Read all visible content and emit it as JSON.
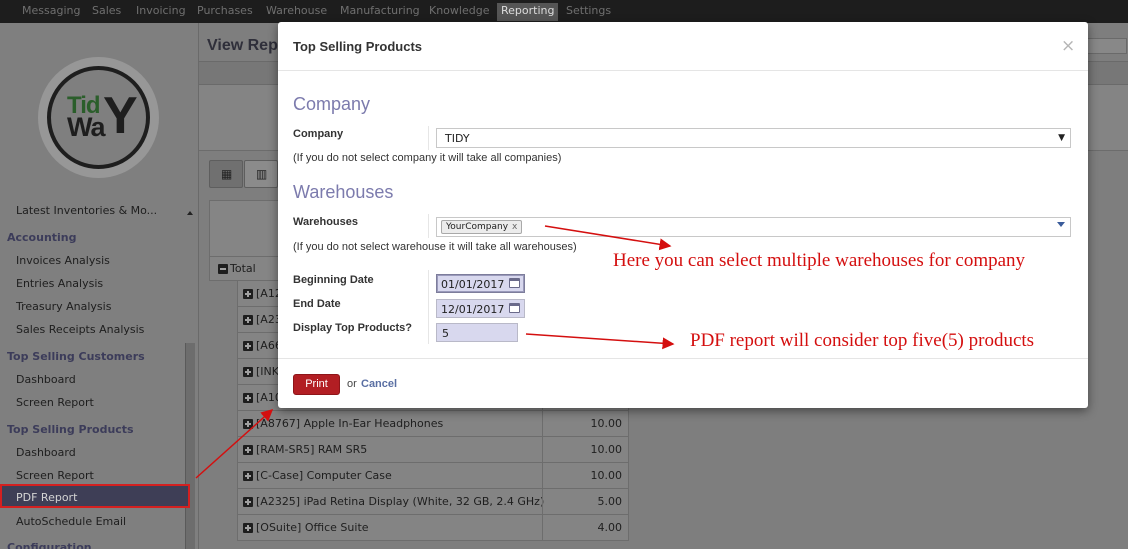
{
  "topbar": {
    "items": [
      "Messaging",
      "Sales",
      "Invoicing",
      "Purchases",
      "Warehouse",
      "Manufacturing",
      "Knowledge",
      "Reporting",
      "Settings"
    ],
    "active": "Reporting"
  },
  "logo": {
    "part1": "Tid",
    "part2": "Wa",
    "part3": "Y"
  },
  "sidebar": {
    "truncated_item": "Latest Inventories & Mo...",
    "sections": [
      {
        "title": "Accounting",
        "items": [
          "Invoices Analysis",
          "Entries Analysis",
          "Treasury Analysis",
          "Sales Receipts Analysis"
        ]
      },
      {
        "title": "Top Selling Customers",
        "items": [
          "Dashboard",
          "Screen Report"
        ]
      },
      {
        "title": "Top Selling Products",
        "items": [
          "Dashboard",
          "Screen Report",
          "PDF Report",
          "AutoSchedule Email"
        ]
      },
      {
        "title": "Configuration",
        "items": []
      }
    ],
    "selected": "PDF Report"
  },
  "main": {
    "title": "View Rep",
    "total_label": "Total",
    "rows": [
      {
        "name": "[A12",
        "value": ""
      },
      {
        "name": "[A23",
        "value": ""
      },
      {
        "name": "[A66",
        "value": ""
      },
      {
        "name": "[INK",
        "value": ""
      },
      {
        "name": "[A10",
        "value": ""
      },
      {
        "name": "[A8767] Apple In-Ear Headphones",
        "value": "10.00"
      },
      {
        "name": "[RAM-SR5] RAM SR5",
        "value": "10.00"
      },
      {
        "name": "[C-Case] Computer Case",
        "value": "10.00"
      },
      {
        "name": "[A2325] iPad Retina Display (White, 32 GB, 2.4 GHz)",
        "value": "5.00"
      },
      {
        "name": "[OSuite] Office Suite",
        "value": "4.00"
      }
    ]
  },
  "modal": {
    "title": "Top Selling Products",
    "close": "×",
    "company_section": "Company",
    "company_label": "Company",
    "company_value": "TIDY",
    "company_hint": "(If you do not select company it will take all companies)",
    "warehouse_section": "Warehouses",
    "warehouse_label": "Warehouses",
    "warehouse_tag": "YourCompany",
    "warehouse_tag_remove": "x",
    "warehouse_hint": "(If you do not select warehouse it will take all warehouses)",
    "beginning_label": "Beginning Date",
    "beginning_value": "01/01/2017",
    "end_label": "End Date",
    "end_value": "12/01/2017",
    "top_label": "Display Top Products?",
    "top_value": "5",
    "print": "Print",
    "or": "or",
    "cancel": "Cancel"
  },
  "annotations": {
    "warehouses": "Here you can select multiple warehouses for company",
    "top_products": "PDF report will consider top five(5) products"
  },
  "colors": {
    "accent_red": "#d40f0f",
    "section_title": "#7c7bad",
    "print_button": "#b21e23"
  }
}
